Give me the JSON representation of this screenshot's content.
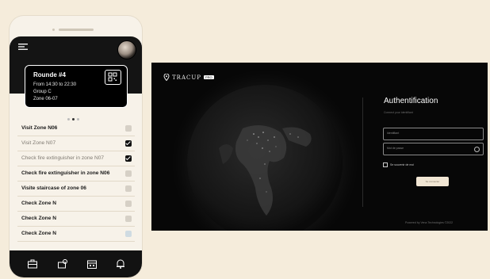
{
  "mobile": {
    "round": {
      "title": "Rounde #4",
      "time": "From 14:30 to 22:30",
      "group": "Group C",
      "zone": "Zone 06-07"
    },
    "carousel": {
      "count": 3,
      "active": 2
    },
    "tasks": [
      {
        "label": "Visit Zone N06",
        "checked": false
      },
      {
        "label": "Visit Zone N07",
        "checked": true
      },
      {
        "label": "Check fire extinguisher in zone N07",
        "checked": true
      },
      {
        "label": "Check fire extinguisher in zone N06",
        "checked": false
      },
      {
        "label": "Visite staircase of zone 06",
        "checked": false
      },
      {
        "label": "Check Zone N",
        "checked": false
      },
      {
        "label": "Check Zone N",
        "checked": false
      },
      {
        "label": "Check Zone N",
        "checked": false
      }
    ],
    "tabs": [
      "briefcase-icon",
      "map-pin-icon",
      "calendar-icon",
      "bell-icon"
    ]
  },
  "desktop": {
    "brand": {
      "name": "TRACUP",
      "badge": "PRO"
    },
    "auth": {
      "title": "Authentification",
      "subtitle": "Connect your identifiant",
      "username_label": "Identifiant",
      "password_label": "Mot de passe",
      "remember_label": "Se souvenir de moi",
      "login_label": "Se connecter"
    },
    "footer": "Powered by Vena Technologies ©2022"
  },
  "colors": {
    "background": "#f5ecdb",
    "dark": "#141414",
    "accent": "#f1e6d4"
  }
}
